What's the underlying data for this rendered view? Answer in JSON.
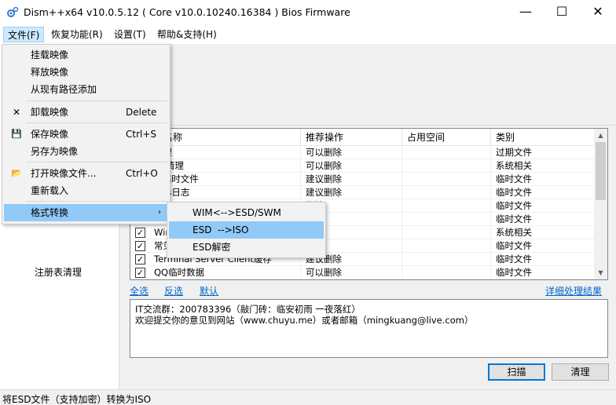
{
  "window": {
    "title": "Dism++x64 v10.0.5.12 ( Core v10.0.10240.16384 ) Bios Firmware",
    "minimize_glyph": "—",
    "maximize_glyph": "☐",
    "close_glyph": "✕"
  },
  "menubar": {
    "items": [
      {
        "label": "文件(F)"
      },
      {
        "label": "恢复功能(R)"
      },
      {
        "label": "设置(T)"
      },
      {
        "label": "帮助&支持(H)"
      }
    ]
  },
  "left_pane": {
    "label": "注册表清理"
  },
  "listview": {
    "columns": [
      "名称",
      "推荐操作",
      "占用空间",
      "类别"
    ],
    "rows": [
      {
        "name": "清理",
        "action": "可以删除",
        "size": "",
        "category": "过期文件",
        "checked": false
      },
      {
        "name": "ler清理",
        "action": "可以删除",
        "size": "",
        "category": "系统相关",
        "checked": false
      },
      {
        "name": "SI临时文件",
        "action": "建议删除",
        "size": "",
        "category": "临时文件",
        "checked": false
      },
      {
        "name": "ows日志",
        "action": "建议删除",
        "size": "",
        "category": "临时文件",
        "checked": false
      },
      {
        "name": "",
        "action": "删除",
        "size": "",
        "category": "临时文件",
        "checked": false
      },
      {
        "name": "",
        "action": "删除",
        "size": "",
        "category": "临时文件",
        "checked": false
      },
      {
        "name": "Winc",
        "action": "删除",
        "size": "",
        "category": "系统相关",
        "checked": true
      },
      {
        "name": "常见",
        "action": "删除",
        "size": "",
        "category": "临时文件",
        "checked": true
      },
      {
        "name": "Terminal Server Client缓存",
        "action": "建议删除",
        "size": "",
        "category": "临时文件",
        "checked": true
      },
      {
        "name": "QQ临时数据",
        "action": "可以删除",
        "size": "",
        "category": "临时文件",
        "checked": true
      }
    ],
    "check_glyph": "✓"
  },
  "links": {
    "select_all": "全选",
    "invert": "反选",
    "default": "默认",
    "details": "详细处理结果"
  },
  "info": {
    "line1": "IT交流群：200783396（敲门砖：临安初雨 一夜落红）",
    "line2": "欢迎提交你的意见到网站（www.chuyu.me）或者邮箱（mingkuang@live.com）"
  },
  "buttons": {
    "scan": "扫描",
    "clean": "清理"
  },
  "status": {
    "text": "将ESD文件（支持加密）转换为ISO"
  },
  "file_menu": {
    "items": [
      {
        "label": "挂载映像",
        "shortcut": "",
        "icon": ""
      },
      {
        "label": "释放映像",
        "shortcut": "",
        "icon": ""
      },
      {
        "label": "从现有路径添加",
        "shortcut": "",
        "icon": ""
      },
      {
        "label": "卸载映像",
        "shortcut": "Delete",
        "icon": "✕"
      },
      {
        "label": "保存映像",
        "shortcut": "Ctrl+S",
        "icon": "💾"
      },
      {
        "label": "另存为映像",
        "shortcut": "",
        "icon": ""
      },
      {
        "label": "打开映像文件...",
        "shortcut": "Ctrl+O",
        "icon": "📂"
      },
      {
        "label": "重新载入",
        "shortcut": "",
        "icon": ""
      },
      {
        "label": "格式转换",
        "shortcut": "",
        "icon": "",
        "arrow": "›"
      }
    ]
  },
  "convert_submenu": {
    "items": [
      {
        "label": "WIM<-->ESD/SWM"
      },
      {
        "label": "ESD  -->ISO"
      },
      {
        "label": "ESD解密"
      }
    ]
  },
  "colors": {
    "menu_highlight": "#91c9f7",
    "link": "#0066cc",
    "primary_border": "#0078d7"
  }
}
